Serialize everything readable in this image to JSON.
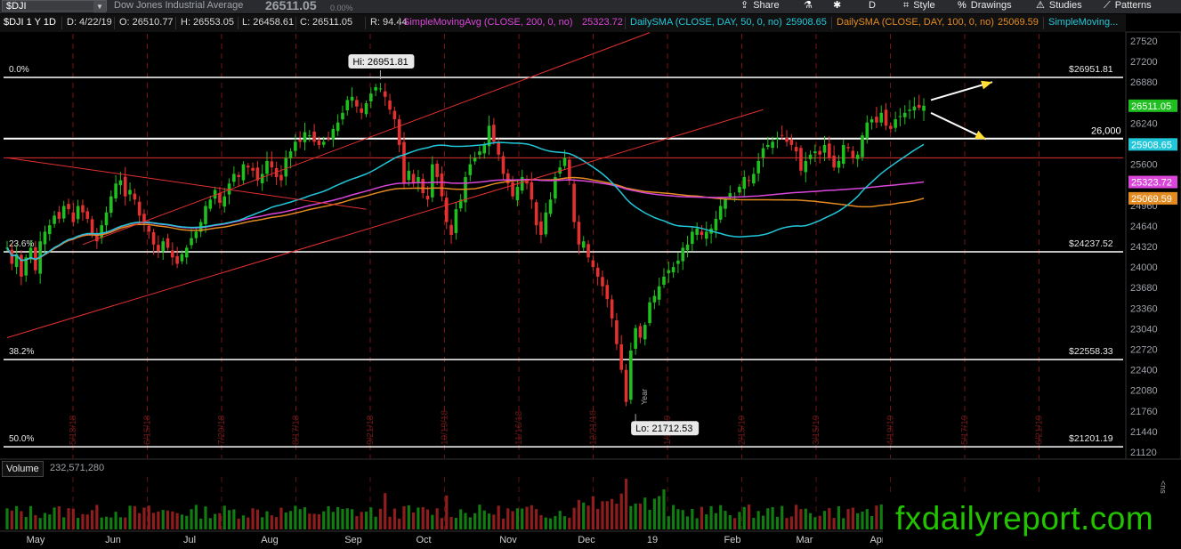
{
  "toolbar": {
    "symbol": "$DJI",
    "company": "Dow Jones Industrial Average",
    "last": "26511.05",
    "change_pct": "0.00%",
    "share": "Share",
    "style": "Style",
    "drawings": "Drawings",
    "studies": "Studies",
    "patterns": "Patterns",
    "aggregation": "D"
  },
  "infobar": {
    "title": "$DJI 1 Y 1D",
    "date": "D: 4/22/19",
    "open": "O: 26510.77",
    "high": "H: 26553.05",
    "low": "L: 26458.61",
    "close": "C: 26511.05",
    "range": "R: 94.44",
    "sma200_label": "SimpleMovingAvg (CLOSE, 200, 0, no)",
    "sma200_value": "25323.72",
    "sma50_label": "DailySMA (CLOSE, DAY, 50, 0, no)",
    "sma50_value": "25908.65",
    "sma100_label": "DailySMA (CLOSE, DAY, 100, 0, no)",
    "sma100_value": "25069.59",
    "more_label": "SimpleMoving..."
  },
  "colors": {
    "up": "#1fbf1f",
    "down": "#e33030",
    "sma50": "#21c7d9",
    "sma100": "#e38a20",
    "sma200": "#d946d9",
    "channel": "#e33030",
    "fib": "#ffffff",
    "watermark": "#22c400"
  },
  "volume": {
    "label": "Volume",
    "value": "232,571,280",
    "scale": "<ns"
  },
  "watermark": "fxdailyreport.com",
  "chart_data": {
    "type": "candlestick",
    "title": "$DJI 1 Y 1D",
    "symbol": "$DJI",
    "ylim": [
      21120,
      27520
    ],
    "y_ticks": [
      27520,
      27200,
      26880,
      26560,
      26240,
      25920,
      25600,
      25280,
      24960,
      24640,
      24320,
      24000,
      23680,
      23360,
      23040,
      22720,
      22400,
      22080,
      21760,
      21440,
      21120
    ],
    "x_month_labels": [
      "May",
      "Jun",
      "Jul",
      "Aug",
      "Sep",
      "Oct",
      "Nov",
      "Dec",
      "19",
      "Feb",
      "Mar",
      "Apr"
    ],
    "vertical_date_labels": [
      "5/18/18",
      "6/15/18",
      "7/20/18",
      "8/17/18",
      "9/21/18",
      "10/19/18",
      "11/16/18",
      "12/21/18",
      "1/18/19",
      "2/15/19",
      "3/15/19",
      "4/19/19",
      "5/17/19",
      "6/21/19"
    ],
    "series": [
      {
        "name": "$DJI",
        "note": "approximate daily closes, Apr 2018 - Apr 22 2019",
        "close": [
          24300,
          24050,
          24200,
          23850,
          24150,
          24300,
          23950,
          24400,
          24550,
          24650,
          24800,
          24750,
          24950,
          24900,
          24700,
          24950,
          24850,
          24750,
          24500,
          24400,
          24650,
          24850,
          25100,
          25300,
          25350,
          25100,
          25200,
          25050,
          24800,
          24700,
          24550,
          24350,
          24250,
          24400,
          24300,
          24150,
          24050,
          24200,
          24300,
          24450,
          24550,
          24700,
          24950,
          25050,
          25200,
          25000,
          25100,
          25300,
          25450,
          25400,
          25600,
          25550,
          25500,
          25350,
          25450,
          25650,
          25550,
          25400,
          25350,
          25700,
          25800,
          25950,
          25950,
          26100,
          26050,
          25950,
          25900,
          25950,
          26000,
          26150,
          26250,
          26400,
          26600,
          26650,
          26500,
          26400,
          26550,
          26700,
          26800,
          26780,
          26650,
          26450,
          26300,
          25900,
          25300,
          25500,
          25300,
          25400,
          25150,
          25050,
          25600,
          25400,
          25100,
          24700,
          24500,
          24900,
          25050,
          25400,
          25600,
          25700,
          25800,
          25900,
          26200,
          25950,
          25750,
          25450,
          25300,
          25100,
          25250,
          25400,
          25300,
          25050,
          24650,
          24500,
          24850,
          25050,
          25400,
          25550,
          25700,
          25350,
          24700,
          24350,
          24400,
          24150,
          24000,
          23850,
          23700,
          23500,
          23200,
          22800,
          22400,
          21900,
          22700,
          23050,
          22900,
          23100,
          23450,
          23550,
          23700,
          23850,
          23950,
          24000,
          24100,
          24300,
          24350,
          24550,
          24600,
          24500,
          24550,
          24600,
          24750,
          24950,
          25050,
          25150,
          25100,
          25250,
          25400,
          25350,
          25450,
          25650,
          25850,
          25900,
          25950,
          26000,
          26050,
          25950,
          25900,
          25800,
          25500,
          25650,
          25750,
          25800,
          25750,
          25900,
          25700,
          25550,
          25650,
          25900,
          25850,
          25700,
          25750,
          26050,
          26250,
          26300,
          26250,
          26400,
          26200,
          26150,
          26300,
          26350,
          26400,
          26450,
          26500,
          26480,
          26511
        ]
      },
      {
        "name": "SimpleMovingAvg (CLOSE, 200, 0, no)",
        "last": 25323.72
      },
      {
        "name": "DailySMA (CLOSE, DAY, 50, 0, no)",
        "last": 25908.65
      },
      {
        "name": "DailySMA (CLOSE, DAY, 100, 0, no)",
        "last": 25069.59
      }
    ],
    "fibonacci": [
      {
        "label": "0.0%",
        "value": 26951.81,
        "value_label": "$26951.81"
      },
      {
        "label": "23.6%",
        "value": 24237.52,
        "value_label": "$24237.52"
      },
      {
        "label": "38.2%",
        "value": 22558.33,
        "value_label": "$22558.33"
      },
      {
        "label": "50.0%",
        "value": 21201.19,
        "value_label": "$21201.19"
      }
    ],
    "horizontal_levels": [
      {
        "label": "26,000",
        "value": 26000
      },
      {
        "value": 25700
      }
    ],
    "annotations": {
      "high": "Hi: 26951.81",
      "low": "Lo: 21712.53",
      "year_marker": "Year"
    },
    "price_bubbles": [
      {
        "label": "26511.05",
        "value": 26511.05,
        "color": "#1fbf1f"
      },
      {
        "label": "25908.65",
        "value": 25908.65,
        "color": "#21c7d9"
      },
      {
        "label": "25323.72",
        "value": 25323.72,
        "color": "#d946d9"
      },
      {
        "label": "25069.59",
        "value": 25069.59,
        "color": "#e38a20"
      }
    ],
    "grid": true
  }
}
